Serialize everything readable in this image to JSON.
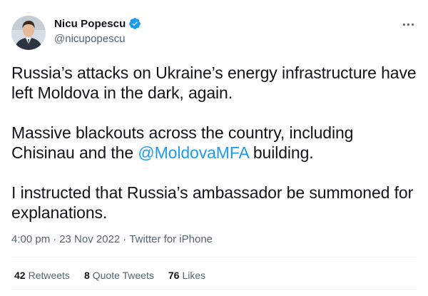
{
  "author": {
    "display_name": "Nicu Popescu",
    "handle": "@nicupopescu",
    "verified": true
  },
  "tweet": {
    "paragraphs": {
      "p1": "Russia’s attacks on Ukraine’s energy infrastructure have left Moldova in the dark, again.",
      "p2_before": "Massive blackouts across the country, including Chisinau and the ",
      "p2_mention": "@MoldovaMFA",
      "p2_after": " building.",
      "p3": "I instructed that Russia’s ambassador be summoned for explanations."
    }
  },
  "meta": {
    "time": "4:00 pm",
    "separator": "·",
    "date": "23 Nov 2022",
    "source": "Twitter for iPhone"
  },
  "stats": {
    "retweets_count": "42",
    "retweets_label": "Retweets",
    "quotes_count": "8",
    "quotes_label": "Quote Tweets",
    "likes_count": "76",
    "likes_label": "Likes"
  },
  "colors": {
    "accent": "#1d9bf0",
    "text": "#0f1419",
    "secondary": "#536471"
  },
  "icons": {
    "verified": "verified-badge-icon",
    "more": "more-horizontal-icon"
  }
}
